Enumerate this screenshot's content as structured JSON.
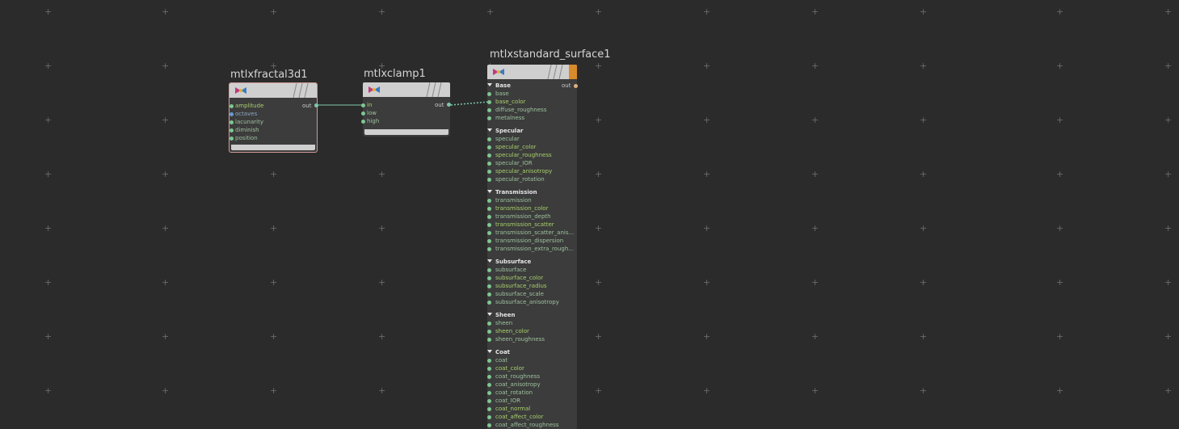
{
  "nodes": {
    "fractal": {
      "title": "mtlxfractal3d1",
      "inputs": [
        "amplitude",
        "octaves",
        "lacunarity",
        "diminish",
        "position"
      ],
      "output": "out"
    },
    "clamp": {
      "title": "mtlxclamp1",
      "inputs": [
        "in",
        "low",
        "high"
      ],
      "output": "out"
    },
    "surface": {
      "title": "mtlxstandard_surface1",
      "output": "out",
      "sections": [
        {
          "name": "Base",
          "inputs": [
            "base",
            "base_color",
            "diffuse_roughness",
            "metalness"
          ]
        },
        {
          "name": "Specular",
          "inputs": [
            "specular",
            "specular_color",
            "specular_roughness",
            "specular_IOR",
            "specular_anisotropy",
            "specular_rotation"
          ]
        },
        {
          "name": "Transmission",
          "inputs": [
            "transmission",
            "transmission_color",
            "transmission_depth",
            "transmission_scatter",
            "transmission_scatter_anis...",
            "transmission_dispersion",
            "transmission_extra_rough..."
          ]
        },
        {
          "name": "Subsurface",
          "inputs": [
            "subsurface",
            "subsurface_color",
            "subsurface_radius",
            "subsurface_scale",
            "subsurface_anisotropy"
          ]
        },
        {
          "name": "Sheen",
          "inputs": [
            "sheen",
            "sheen_color",
            "sheen_roughness"
          ]
        },
        {
          "name": "Coat",
          "inputs": [
            "coat",
            "coat_color",
            "coat_roughness",
            "coat_anisotropy",
            "coat_rotation",
            "coat_IOR",
            "coat_normal",
            "coat_affect_color",
            "coat_affect_roughness"
          ]
        }
      ]
    }
  },
  "colors": {
    "background": "#2b2b2b",
    "selected_border": "#d49a9a",
    "output_flag": "#d98a2a",
    "wire": "#7fc7a8"
  }
}
